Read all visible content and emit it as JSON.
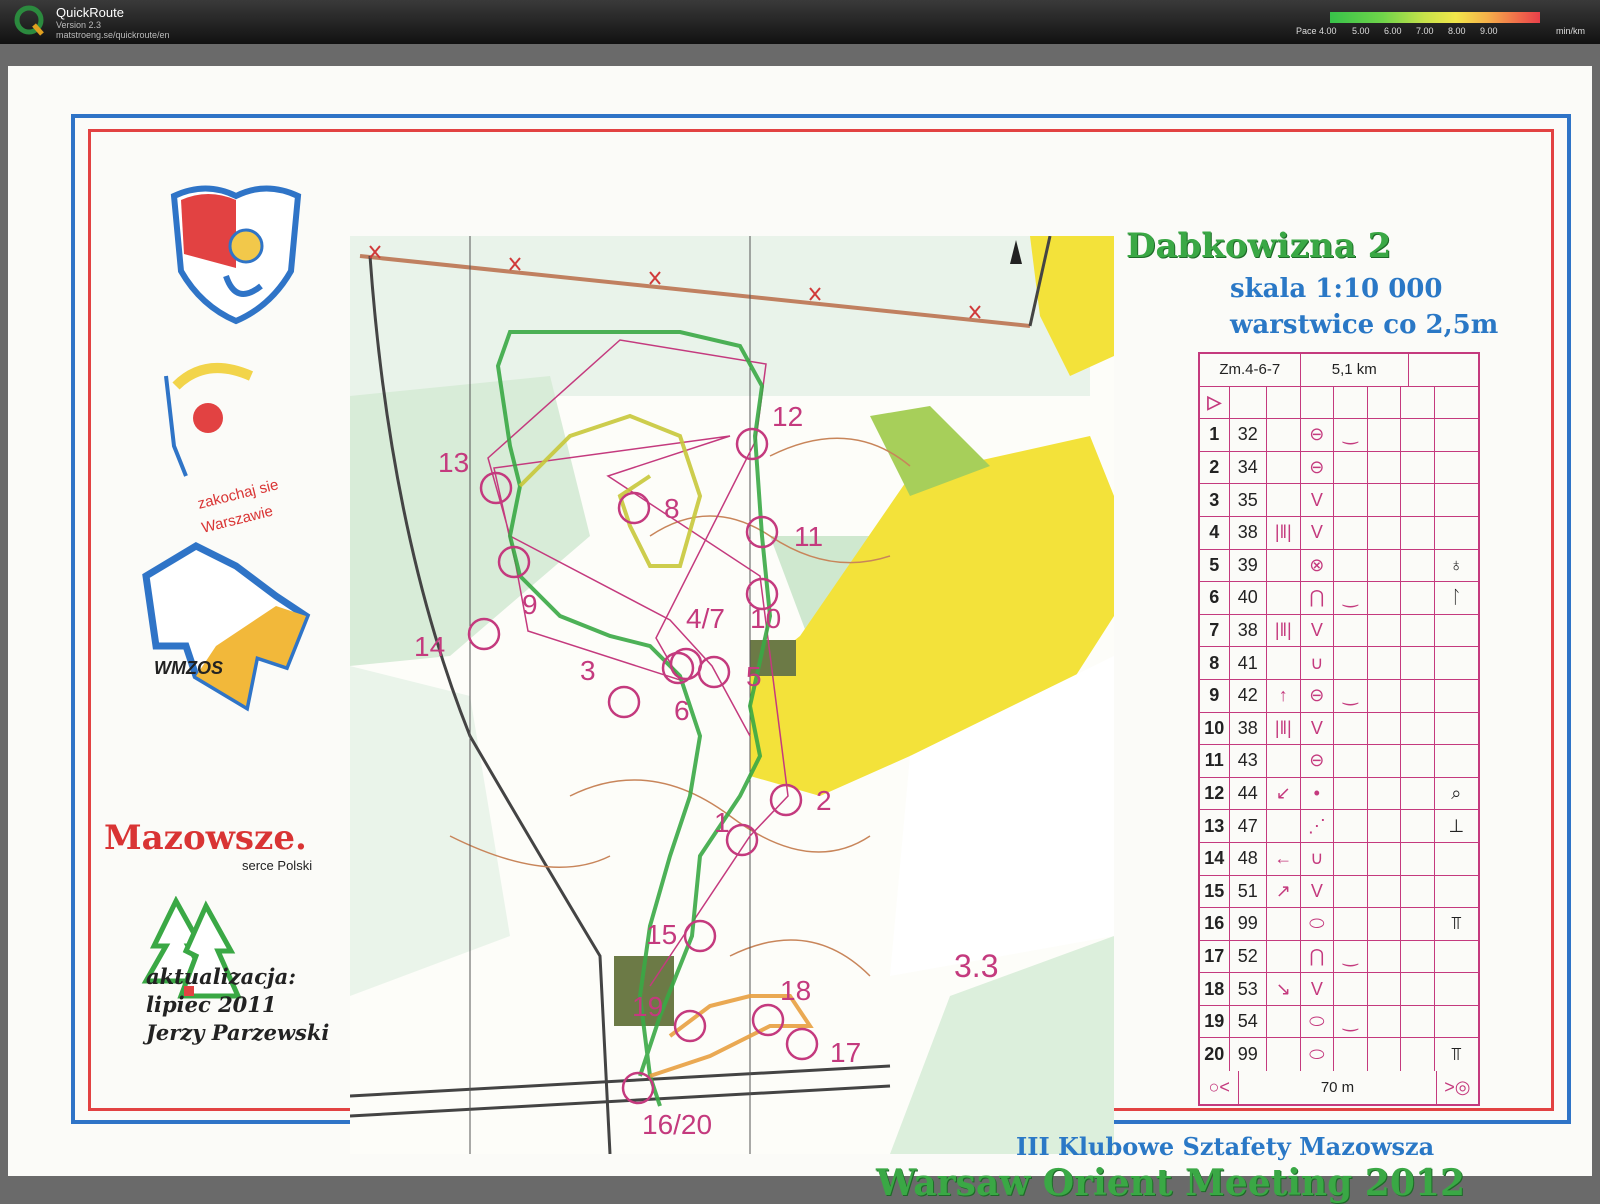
{
  "app": {
    "name": "QuickRoute",
    "version": "Version 2.3",
    "url": "matstroeng.se/quickroute/en",
    "pace_legend": {
      "label": "Pace",
      "values": [
        "4.00",
        "5.00",
        "6.00",
        "7.00",
        "8.00",
        "9.00"
      ],
      "unit": "min/km"
    }
  },
  "map": {
    "name": "Dabkowizna 2",
    "scale": "skala 1:10 000",
    "contour_interval": "warstwice co 2,5m",
    "course_rating": "3.3",
    "control_labels": [
      "1",
      "2",
      "3",
      "4/7",
      "5",
      "6",
      "8",
      "9",
      "10",
      "11",
      "12",
      "13",
      "14",
      "15",
      "16/20",
      "17",
      "18",
      "19"
    ]
  },
  "logos": {
    "zakochaj_line1": "zakochaj sie",
    "zakochaj_line2": "Warszawie",
    "wmzos": "WMZOS",
    "mazowsze": "Mazowsze.",
    "serce": "serce Polski"
  },
  "credits": {
    "line1": "aktualizacja:",
    "line2": "lipiec 2011",
    "line3": "Jerzy Parzewski"
  },
  "event": {
    "series": "III Klubowe Sztafety Mazowsza",
    "name": "Warsaw Orient Meeting 2012"
  },
  "description_sheet": {
    "course": "Zm.4-6-7",
    "length": "5,1 km",
    "start_symbol": "▷",
    "controls": [
      {
        "n": "1",
        "code": "32",
        "dir": "",
        "feature": "⊖",
        "detail": "‿",
        "extra": ""
      },
      {
        "n": "2",
        "code": "34",
        "dir": "",
        "feature": "⊖",
        "detail": "",
        "extra": ""
      },
      {
        "n": "3",
        "code": "35",
        "dir": "",
        "feature": "V",
        "detail": "",
        "extra": ""
      },
      {
        "n": "4",
        "code": "38",
        "dir": "|‖|",
        "feature": "V",
        "detail": "",
        "extra": ""
      },
      {
        "n": "5",
        "code": "39",
        "dir": "",
        "feature": "⊗",
        "detail": "",
        "extra": "♁"
      },
      {
        "n": "6",
        "code": "40",
        "dir": "",
        "feature": "⋂",
        "detail": "‿",
        "extra": "ᛚ"
      },
      {
        "n": "7",
        "code": "38",
        "dir": "|‖|",
        "feature": "V",
        "detail": "",
        "extra": ""
      },
      {
        "n": "8",
        "code": "41",
        "dir": "",
        "feature": "∪",
        "detail": "",
        "extra": ""
      },
      {
        "n": "9",
        "code": "42",
        "dir": "↑",
        "feature": "⊖",
        "detail": "‿",
        "extra": ""
      },
      {
        "n": "10",
        "code": "38",
        "dir": "|‖|",
        "feature": "V",
        "detail": "",
        "extra": ""
      },
      {
        "n": "11",
        "code": "43",
        "dir": "",
        "feature": "⊖",
        "detail": "",
        "extra": ""
      },
      {
        "n": "12",
        "code": "44",
        "dir": "↙",
        "feature": "•",
        "detail": "",
        "extra": "⌕"
      },
      {
        "n": "13",
        "code": "47",
        "dir": "",
        "feature": "⋰",
        "detail": "",
        "extra": "⊥"
      },
      {
        "n": "14",
        "code": "48",
        "dir": "←",
        "feature": "∪",
        "detail": "",
        "extra": ""
      },
      {
        "n": "15",
        "code": "51",
        "dir": "↗",
        "feature": "V",
        "detail": "",
        "extra": ""
      },
      {
        "n": "16",
        "code": "99",
        "dir": "",
        "feature": "⬭",
        "detail": "",
        "extra": "⫪"
      },
      {
        "n": "17",
        "code": "52",
        "dir": "",
        "feature": "⋂",
        "detail": "‿",
        "extra": ""
      },
      {
        "n": "18",
        "code": "53",
        "dir": "↘",
        "feature": "V",
        "detail": "",
        "extra": ""
      },
      {
        "n": "19",
        "code": "54",
        "dir": "",
        "feature": "⬭",
        "detail": "‿",
        "extra": ""
      },
      {
        "n": "20",
        "code": "99",
        "dir": "",
        "feature": "⬭",
        "detail": "",
        "extra": "⫪"
      }
    ],
    "finish": {
      "left": "○<",
      "distance": "70 m",
      "right": ">◎"
    }
  }
}
